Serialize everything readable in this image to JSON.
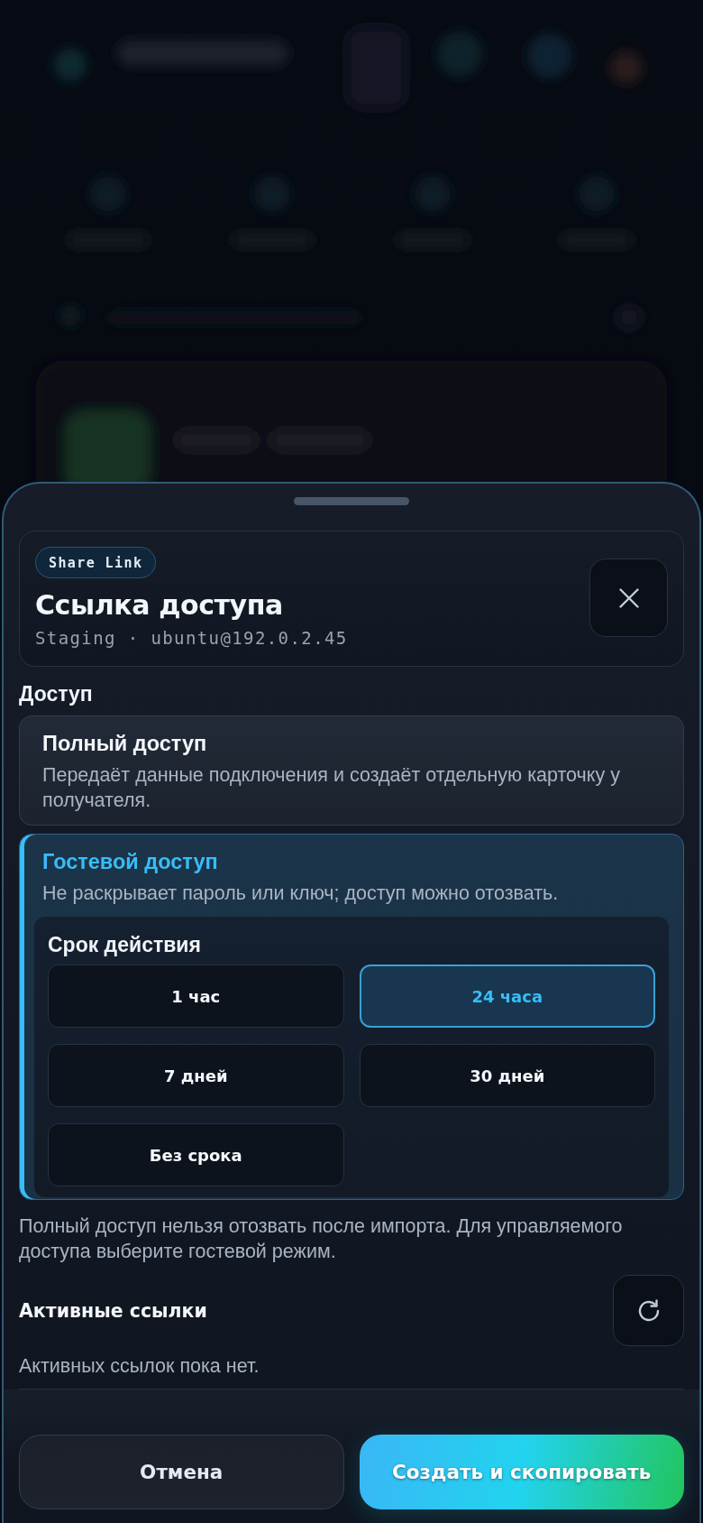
{
  "sheet": {
    "badge": "Share Link",
    "title": "Ссылка доступа",
    "subtitle": "Staging · ubuntu@192.0.2.45"
  },
  "access": {
    "label": "Доступ",
    "options": [
      {
        "title": "Полный доступ",
        "description": "Передаёт данные подключения и создаёт отдельную карточку у получателя.",
        "selected": false
      },
      {
        "title": "Гостевой доступ",
        "description": "Не раскрывает пароль или ключ; доступ можно отозвать.",
        "selected": true,
        "expiry": {
          "label": "Срок действия",
          "options": [
            {
              "label": "1 час",
              "selected": false
            },
            {
              "label": "24 часа",
              "selected": true
            },
            {
              "label": "7 дней",
              "selected": false
            },
            {
              "label": "30 дней",
              "selected": false
            },
            {
              "label": "Без срока",
              "selected": false
            }
          ]
        }
      }
    ]
  },
  "note": "Полный доступ нельзя отозвать после импорта. Для управляемого доступа выберите гостевой режим.",
  "active_links": {
    "title": "Активные ссылки",
    "empty_text": "Активных ссылок пока нет."
  },
  "buttons": [
    {
      "label": "Отмена",
      "kind": "secondary"
    },
    {
      "label": "Создать и скопировать",
      "kind": "primary"
    }
  ]
}
